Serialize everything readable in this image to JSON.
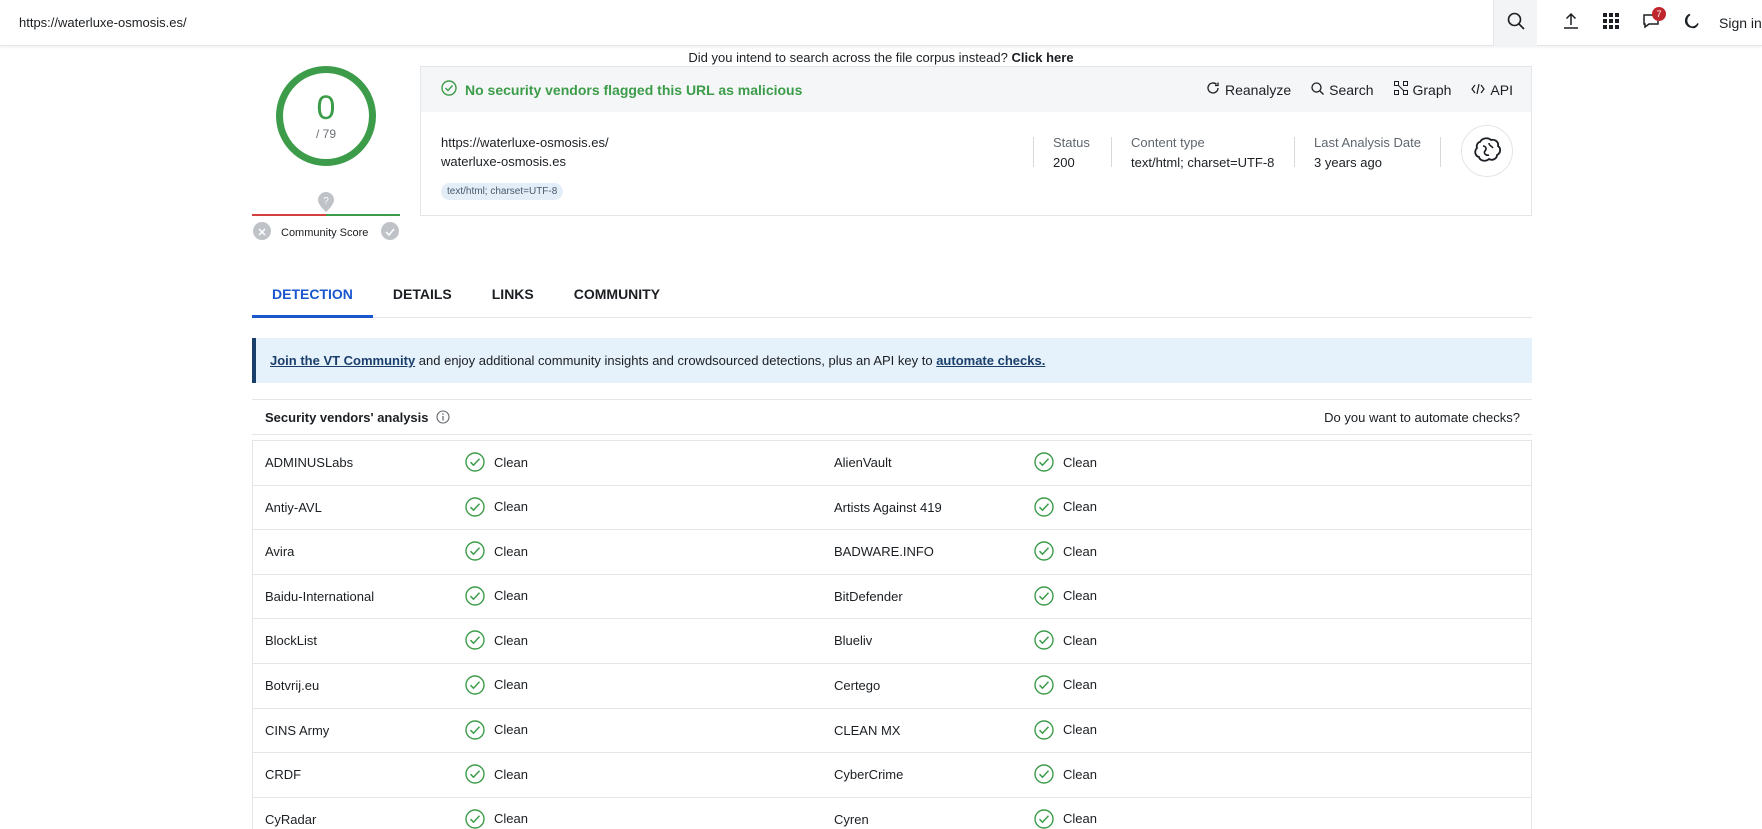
{
  "topbar": {
    "url_value": "https://waterluxe-osmosis.es/",
    "notification_count": "7",
    "sign_in_label": "Sign in"
  },
  "corpus_note": {
    "text": "Did you intend to search across the file corpus instead?",
    "link": "Click here"
  },
  "score": {
    "detections": "0",
    "total": "/ 79",
    "community_label": "Community Score"
  },
  "summary": {
    "verdict": "No security vendors flagged this URL as malicious",
    "actions": {
      "reanalyze": "Reanalyze",
      "search": "Search",
      "graph": "Graph",
      "api": "API"
    },
    "url": "https://waterluxe-osmosis.es/",
    "domain": "waterluxe-osmosis.es",
    "tag": "text/html; charset=UTF-8",
    "status_label": "Status",
    "status_value": "200",
    "content_type_label": "Content type",
    "content_type_value": "text/html; charset=UTF-8",
    "last_analysis_label": "Last Analysis Date",
    "last_analysis_value": "3 years ago"
  },
  "tabs": [
    "DETECTION",
    "DETAILS",
    "LINKS",
    "COMMUNITY"
  ],
  "banner": {
    "link1": "Join the VT Community",
    "text": " and enjoy additional community insights and crowdsourced detections, plus an API key to ",
    "link2": "automate checks."
  },
  "analysis": {
    "title": "Security vendors' analysis",
    "automate": "Do you want to automate checks?"
  },
  "vendors": [
    {
      "left": "ADMINUSLabs",
      "left_result": "Clean",
      "right": "AlienVault",
      "right_result": "Clean"
    },
    {
      "left": "Antiy-AVL",
      "left_result": "Clean",
      "right": "Artists Against 419",
      "right_result": "Clean"
    },
    {
      "left": "Avira",
      "left_result": "Clean",
      "right": "BADWARE.INFO",
      "right_result": "Clean"
    },
    {
      "left": "Baidu-International",
      "left_result": "Clean",
      "right": "BitDefender",
      "right_result": "Clean"
    },
    {
      "left": "BlockList",
      "left_result": "Clean",
      "right": "Blueliv",
      "right_result": "Clean"
    },
    {
      "left": "Botvrij.eu",
      "left_result": "Clean",
      "right": "Certego",
      "right_result": "Clean"
    },
    {
      "left": "CINS Army",
      "left_result": "Clean",
      "right": "CLEAN MX",
      "right_result": "Clean"
    },
    {
      "left": "CRDF",
      "left_result": "Clean",
      "right": "CyberCrime",
      "right_result": "Clean"
    },
    {
      "left": "CyRadar",
      "left_result": "Clean",
      "right": "Cyren",
      "right_result": "Clean"
    }
  ],
  "colors": {
    "clean_green": "#3c9c4a",
    "accent_blue": "#1a57cf",
    "banner_bg": "#e5f1fb"
  },
  "icons": {
    "search": "search-icon",
    "upload": "upload-icon",
    "apps": "apps-grid-icon",
    "notifications": "chat-notification-icon",
    "theme": "moon-icon",
    "clean": "check-circle-icon"
  }
}
